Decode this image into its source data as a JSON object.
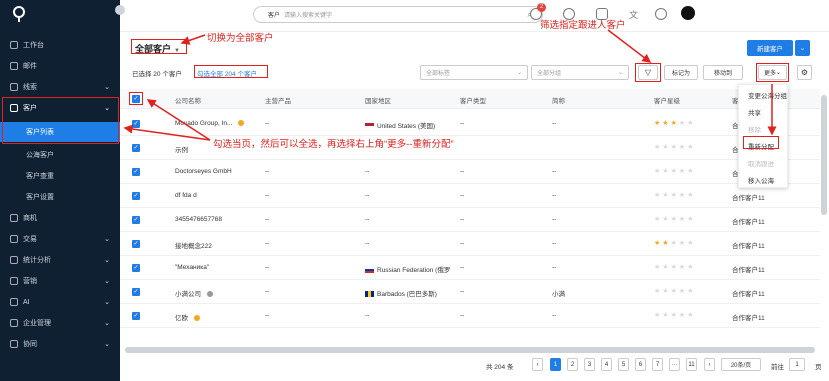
{
  "sidebar": {
    "items": [
      {
        "label": "工作台",
        "chev": ""
      },
      {
        "label": "邮件",
        "chev": ""
      },
      {
        "label": "线索",
        "chev": "⌄"
      },
      {
        "label": "客户",
        "chev": "⌄"
      },
      {
        "label": "商机",
        "chev": ""
      },
      {
        "label": "交易",
        "chev": "⌄"
      },
      {
        "label": "统计分析",
        "chev": "⌄"
      },
      {
        "label": "营销",
        "chev": "⌄"
      },
      {
        "label": "AI",
        "chev": "⌄"
      },
      {
        "label": "企业管理",
        "chev": "⌄"
      },
      {
        "label": "协同",
        "chev": "⌄"
      }
    ],
    "subitems": [
      {
        "label": "客户列表"
      },
      {
        "label": "公海客户"
      },
      {
        "label": "客户查重"
      },
      {
        "label": "客户设置"
      }
    ]
  },
  "topbar": {
    "search_scope": "客户",
    "search_placeholder": "请输入搜索关键字",
    "badge": "2"
  },
  "main": {
    "title": "全部客户",
    "new_button": "新建客户",
    "selected_text": "已选择 20 个客户",
    "select_all_text": "勾选全部 204 个客户",
    "filter_tag": "全部标签",
    "filter_group": "全部分组",
    "btn_mark": "标记为",
    "btn_move": "移动到",
    "btn_more": "更多",
    "columns": [
      "公司名称",
      "主营产品",
      "国家地区",
      "客户类型",
      "简称",
      "客户星级",
      "客户"
    ],
    "rows": [
      {
        "name": "Movado Group, In...",
        "product": "--",
        "country": "United States (美国)",
        "type": "--",
        "abbr": "--",
        "stars": 3,
        "owner": "合作客户"
      },
      {
        "name": "示例",
        "product": "",
        "country": "",
        "type": "",
        "abbr": "",
        "stars": 0,
        "owner": "合作客户"
      },
      {
        "name": "Doctorseyes GmbH",
        "product": "--",
        "country": "--",
        "type": "--",
        "abbr": "--",
        "stars": 0,
        "owner": "合作客户"
      },
      {
        "name": "df fda d",
        "product": "--",
        "country": "--",
        "type": "--",
        "abbr": "--",
        "stars": 0,
        "owner": "合作客户11"
      },
      {
        "name": "3455476657768",
        "product": "--",
        "country": "--",
        "type": "--",
        "abbr": "--",
        "stars": 0,
        "owner": "合作客户11"
      },
      {
        "name": "接地概念222",
        "product": "--",
        "country": "--",
        "type": "--",
        "abbr": "--",
        "stars": 2,
        "owner": "合作客户11"
      },
      {
        "name": "\"Механика\"",
        "product": "--",
        "country": "Russian Federation (俄罗",
        "type": "--",
        "abbr": "--",
        "stars": 0,
        "owner": "合作客户11"
      },
      {
        "name": "小满公司",
        "product": "--",
        "country": "Barbados (巴巴多斯)",
        "type": "--",
        "abbr": "小满",
        "stars": 0,
        "owner": "合作客户11"
      },
      {
        "name": "亿欧",
        "product": "--",
        "country": "--",
        "type": "--",
        "abbr": "--",
        "stars": 0,
        "owner": "合作客户11"
      }
    ],
    "menu": [
      {
        "label": "变更公海分组",
        "disabled": false
      },
      {
        "label": "共享",
        "disabled": false
      },
      {
        "label": "移除",
        "disabled": true
      },
      {
        "label": "重新分配",
        "disabled": false
      },
      {
        "label": "取消跟进",
        "disabled": true
      },
      {
        "label": "移入公海",
        "disabled": false
      }
    ],
    "pager": {
      "total": "共 204 条",
      "pages": [
        "1",
        "2",
        "3",
        "4",
        "5",
        "6",
        "7",
        "···",
        "11"
      ],
      "per_page": "20条/页",
      "goto_label": "前往",
      "goto_value": "1",
      "page_suffix": "页"
    }
  },
  "annotations": {
    "switch": "切换为全部客户",
    "filter": "筛选指定跟进人客户",
    "select": "勾选当页，然后可以全选，再选择右上角“更多--重新分配”"
  },
  "colors": {
    "primary": "#1f7de6",
    "annotation": "#e0211d",
    "sidebar": "#0f2033"
  }
}
